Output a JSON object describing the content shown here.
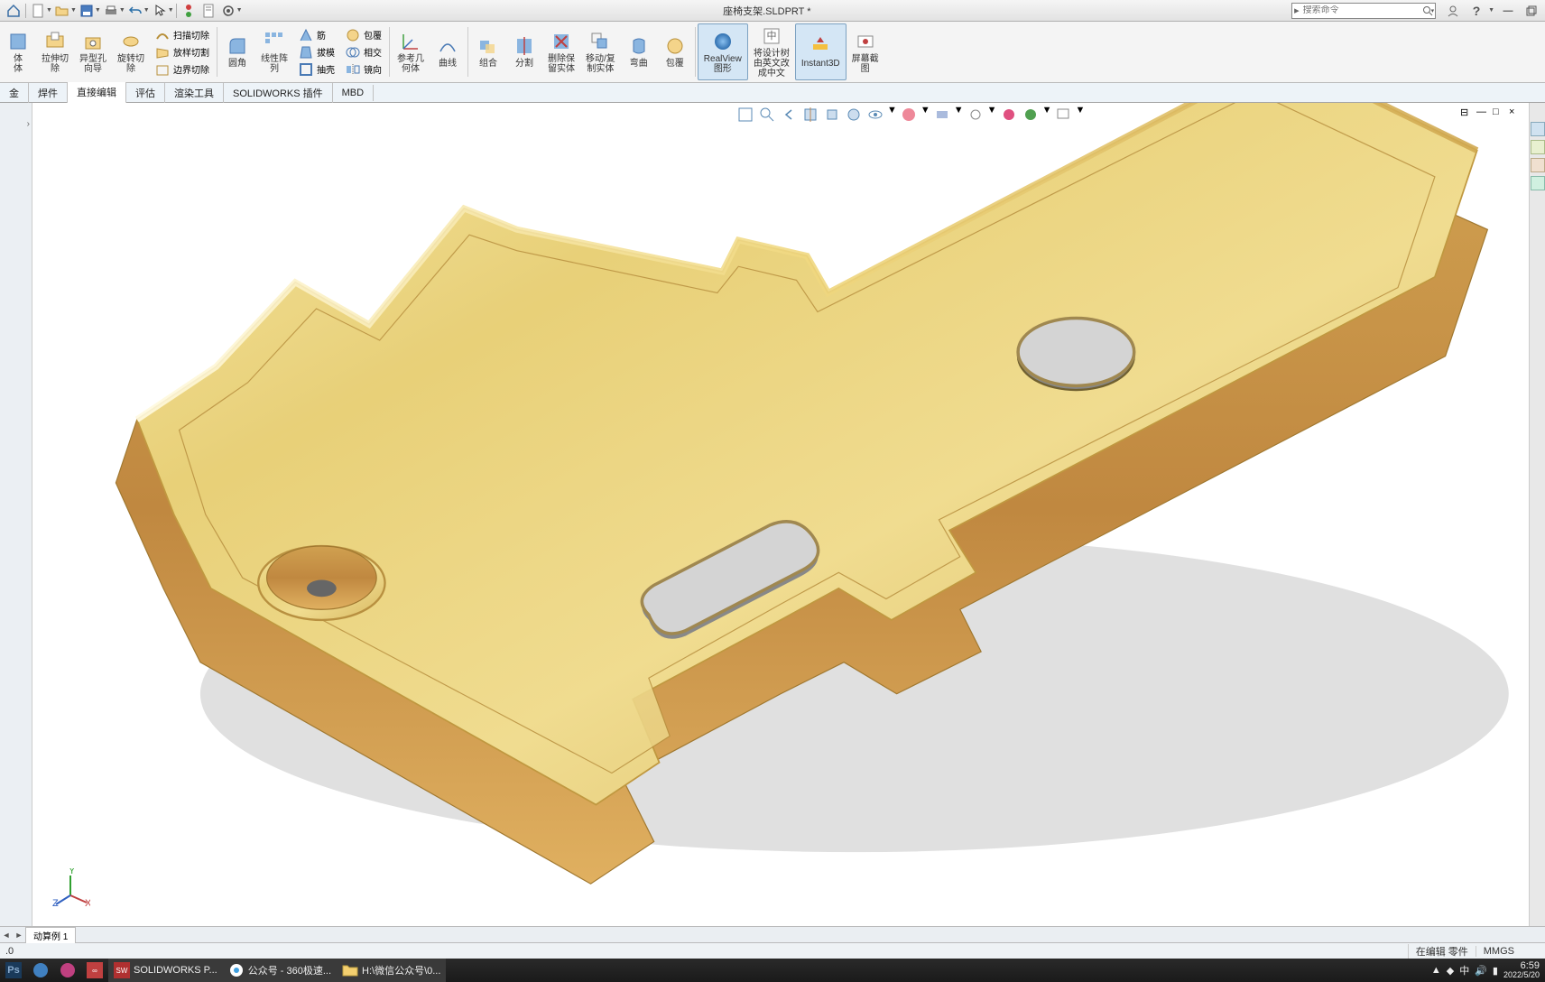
{
  "doc_title": "座椅支架.SLDPRT *",
  "search_placeholder": "搜索命令",
  "topbar": {
    "home": "主页",
    "new": "新建",
    "open": "打开",
    "save": "保存",
    "print": "打印",
    "undo": "撤销",
    "select": "选择",
    "rebuild": "重建",
    "options": "选项"
  },
  "ribbon": {
    "extrude_cut": "体\n体",
    "stretch_cut": "拉伸切\n除",
    "hole_wizard": "异型孔\n向导",
    "revolve_cut": "旋转切\n除",
    "sweep_cut": "扫描切除",
    "loft_cut": "放样切割",
    "boundary_cut": "边界切除",
    "fillet": "圆角",
    "linear_pattern": "线性阵\n列",
    "rib": "筋",
    "draft": "拔模",
    "shell": "抽壳",
    "wrap": "包覆",
    "intersect": "相交",
    "mirror": "镜向",
    "ref_geom": "参考几\n何体",
    "curves": "曲线",
    "combine": "组合",
    "split": "分割",
    "delete_keep": "删除保\n留实体",
    "move_copy": "移动/复\n制实体",
    "bend": "弯曲",
    "wrap2": "包覆",
    "realview": "RealView\n图形",
    "tree_english": "将设计树\n由英文改\n成中文",
    "instant3d": "Instant3D",
    "screenshot": "屏幕截\n图"
  },
  "tabs": [
    "金",
    "焊件",
    "直接编辑",
    "评估",
    "渲染工具",
    "SOLIDWORKS 插件",
    "MBD"
  ],
  "bottom_tab": "动算例 1",
  "status_zoom": ".0",
  "status_edit": "在编辑 零件",
  "status_units": "MMGS",
  "taskbar": {
    "ps": "Ps",
    "solidworks": "SOLIDWORKS P...",
    "wechat": "公众号 - 360极速...",
    "folder": "H:\\微信公众号\\0...",
    "time": "6:59",
    "date": "2022/5/20"
  }
}
